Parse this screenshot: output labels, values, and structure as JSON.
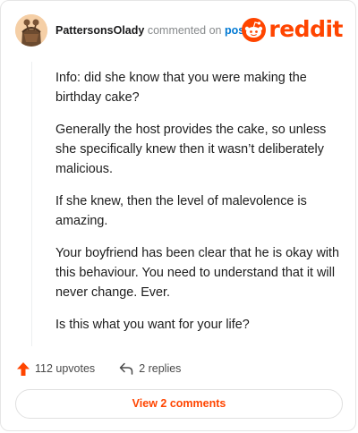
{
  "header": {
    "username": "PattersonsOlady",
    "commented_on": "commented on",
    "post_link": "post",
    "brand": "reddit"
  },
  "comment": {
    "paragraphs": [
      "Info: did she know that you were making the birthday cake?",
      "Generally the host provides the cake, so unless she specifically knew then it wasn’t deliberately malicious.",
      "If she knew, then the level of malevolence is amazing.",
      "Your boyfriend has been clear that he is okay with this behaviour. You need to understand that it will never change. Ever.",
      "Is this what you want for your life?"
    ]
  },
  "actions": {
    "upvotes": "112 upvotes",
    "replies": "2 replies"
  },
  "footer": {
    "view_comments": "View 2 comments"
  },
  "colors": {
    "brand": "#ff4500",
    "link": "#0079d3",
    "muted": "#878a8c"
  },
  "icons": [
    "avatar",
    "reddit-logo-icon",
    "upvote-arrow-icon",
    "reply-icon"
  ]
}
